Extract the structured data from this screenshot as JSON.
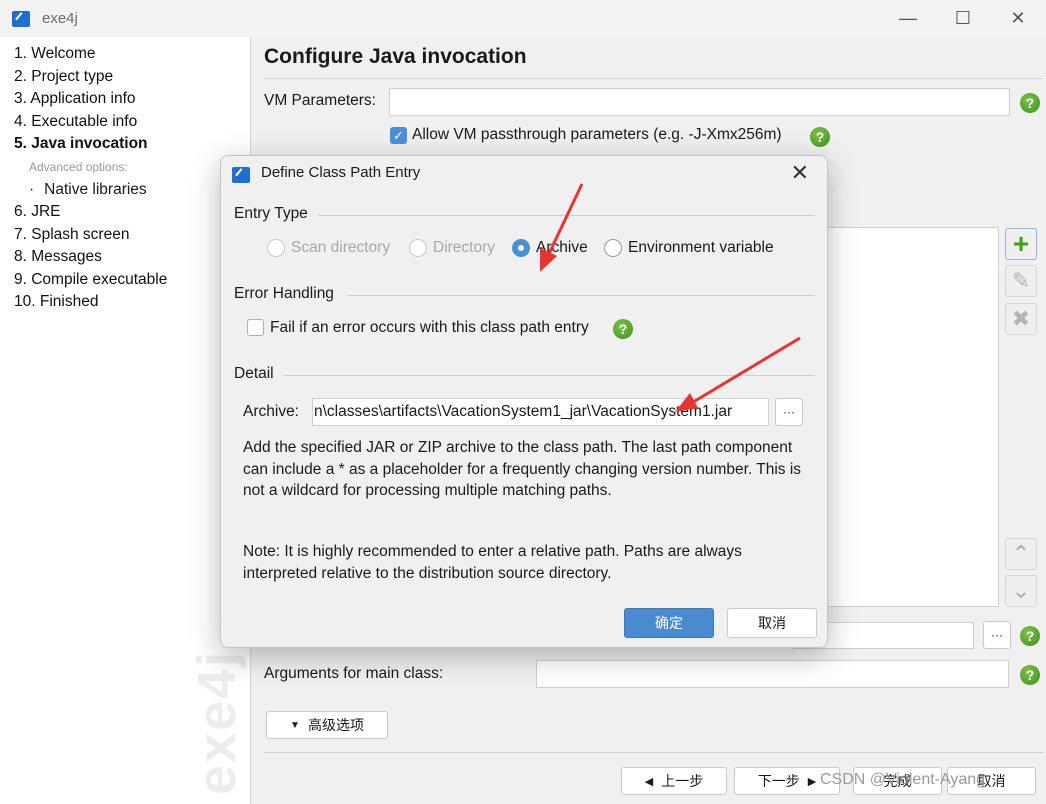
{
  "window": {
    "title": "exe4j",
    "controls": {
      "minimize": "—",
      "maximize": "☐",
      "close": "✕"
    }
  },
  "sidebar": {
    "items": [
      {
        "label": "1. Welcome"
      },
      {
        "label": "2. Project type"
      },
      {
        "label": "3. Application info"
      },
      {
        "label": "4. Executable info"
      },
      {
        "label": "5. Java invocation",
        "active": true
      },
      {
        "label": "Advanced options:"
      },
      {
        "label": "Native libraries"
      },
      {
        "label": "6. JRE"
      },
      {
        "label": "7. Splash screen"
      },
      {
        "label": "8. Messages"
      },
      {
        "label": "9. Compile executable"
      },
      {
        "label": "10. Finished"
      }
    ],
    "bullet": "·",
    "watermark": "exe4j"
  },
  "main": {
    "title": "Configure Java invocation",
    "vm_parameters_label": "VM Parameters:",
    "vm_parameters_value": "",
    "allow_passthrough_label": "Allow VM passthrough parameters (e.g. -J-Xmx256m)",
    "allow_passthrough_checked": true,
    "main_class_value": "",
    "arguments_label": "Arguments for main class:",
    "arguments_value": "",
    "browse_label": "···",
    "help_icon": "?",
    "advanced_button": "高级选项",
    "list_buttons": {
      "add": "+",
      "edit": "✎",
      "remove": "✖",
      "up": "⌃",
      "down": "⌄"
    }
  },
  "footer": {
    "back": "上一步",
    "next": "下一步",
    "finish": "完成",
    "cancel": "取消"
  },
  "dialog": {
    "title": "Define Class Path Entry",
    "close": "✕",
    "entry_type_label": "Entry Type",
    "entry_types": [
      {
        "label": "Scan directory",
        "enabled": false,
        "selected": false
      },
      {
        "label": "Directory",
        "enabled": false,
        "selected": false
      },
      {
        "label": "Archive",
        "enabled": true,
        "selected": true
      },
      {
        "label": "Environment variable",
        "enabled": true,
        "selected": false
      }
    ],
    "error_handling_label": "Error Handling",
    "fail_on_error_label": "Fail if an error occurs with this class path entry",
    "fail_on_error_checked": false,
    "detail_label": "Detail",
    "archive_label": "Archive:",
    "archive_value": "n\\classes\\artifacts\\VacationSystem1_jar\\VacationSystem1.jar",
    "browse_label": "···",
    "description": "Add the specified JAR or ZIP archive to the class path. The last path component can include a * as a placeholder for a frequently changing version number. This is not a wildcard for processing multiple matching paths.",
    "note": "Note: It is highly recommended to enter a relative path. Paths are always interpreted relative to the distribution source directory.",
    "ok": "确定",
    "cancel": "取消"
  },
  "overlay": {
    "watermark": "CSDN @Violent-Ayang",
    "annotation_color": "#e8332f"
  }
}
